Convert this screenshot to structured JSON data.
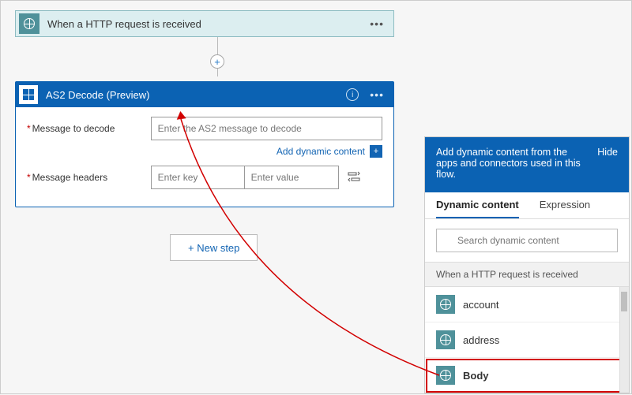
{
  "trigger": {
    "title": "When a HTTP request is received",
    "icon": "http-globe-icon"
  },
  "action": {
    "title": "AS2 Decode  (Preview)",
    "fields": {
      "message_label": "Message to decode",
      "message_placeholder": "Enter the AS2 message to decode",
      "headers_label": "Message headers",
      "key_placeholder": "Enter key",
      "value_placeholder": "Enter value"
    },
    "add_dynamic_content": "Add dynamic content"
  },
  "new_step_label": "+ New step",
  "dynamic_panel": {
    "header_text": "Add dynamic content from the apps and connectors used in this flow.",
    "hide_label": "Hide",
    "tabs": {
      "dynamic": "Dynamic content",
      "expression": "Expression"
    },
    "search_placeholder": "Search dynamic content",
    "section_label": "When a HTTP request is received",
    "items": [
      {
        "label": "account"
      },
      {
        "label": "address"
      },
      {
        "label": "Body"
      }
    ]
  }
}
